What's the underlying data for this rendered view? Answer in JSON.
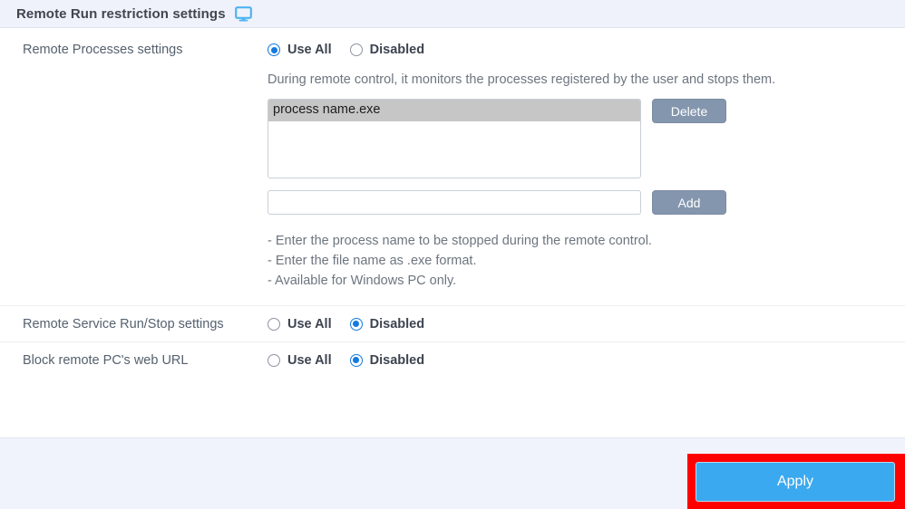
{
  "header": {
    "title": "Remote Run restriction settings",
    "icon": "monitor-icon"
  },
  "rows": {
    "remote_processes": {
      "label": "Remote Processes settings",
      "options": [
        {
          "label": "Use All",
          "selected": true
        },
        {
          "label": "Disabled",
          "selected": false
        }
      ],
      "description": "During remote control, it monitors the processes registered by the user and stops them.",
      "list_items": [
        "process name.exe"
      ],
      "delete_label": "Delete",
      "add_label": "Add",
      "input_value": "",
      "input_placeholder": "",
      "notes": [
        "- Enter the process name to be stopped during the remote control.",
        "- Enter the file name as .exe format.",
        "- Available for Windows PC only."
      ]
    },
    "remote_service": {
      "label": "Remote Service Run/Stop settings",
      "options": [
        {
          "label": "Use All",
          "selected": false
        },
        {
          "label": "Disabled",
          "selected": true
        }
      ]
    },
    "block_url": {
      "label": "Block remote PC's web URL",
      "options": [
        {
          "label": "Use All",
          "selected": false
        },
        {
          "label": "Disabled",
          "selected": true
        }
      ]
    }
  },
  "footer": {
    "apply_label": "Apply"
  },
  "colors": {
    "header_bg": "#eff2fb",
    "footer_bg": "#f0f3fb",
    "accent_blue": "#1479e0",
    "apply_blue": "#3ba9ef",
    "button_gray": "#8396ad",
    "highlight_gray": "#c6c6c6",
    "annotation_red": "#fe0000",
    "icon_blue": "#4fb3f2"
  }
}
